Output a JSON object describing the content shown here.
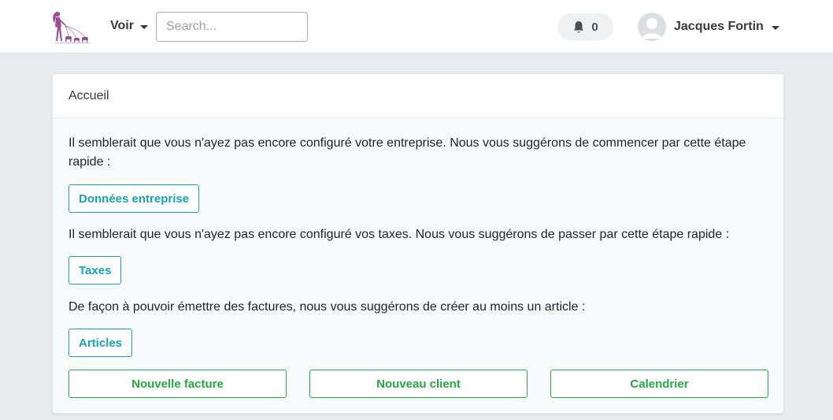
{
  "nav": {
    "logo_icon": "woman-walking-dogs-logo",
    "voir_label": "Voir",
    "search_placeholder": "Search...",
    "notifications_count": "0",
    "user_name": "Jacques Fortin"
  },
  "card": {
    "title": "Accueil",
    "company_msg": "Il semblerait que vous n'ayez pas encore configuré votre entreprise. Nous vous suggérons de commencer par cette étape rapide :",
    "company_btn": "Données entreprise",
    "taxes_msg": "Il semblerait que vous n'ayez pas encore configuré vos taxes. Nous vous suggérons de passer par cette étape rapide :",
    "taxes_btn": "Taxes",
    "articles_msg": "De façon à pouvoir émettre des factures, nous vous suggérons de créer au moins un article :",
    "articles_btn": "Articles",
    "actions": [
      "Nouvelle facture",
      "Nouveau client",
      "Calendrier"
    ]
  },
  "colors": {
    "info": "#17a2b8",
    "success": "#28a745",
    "logo": "#9b4f96"
  }
}
